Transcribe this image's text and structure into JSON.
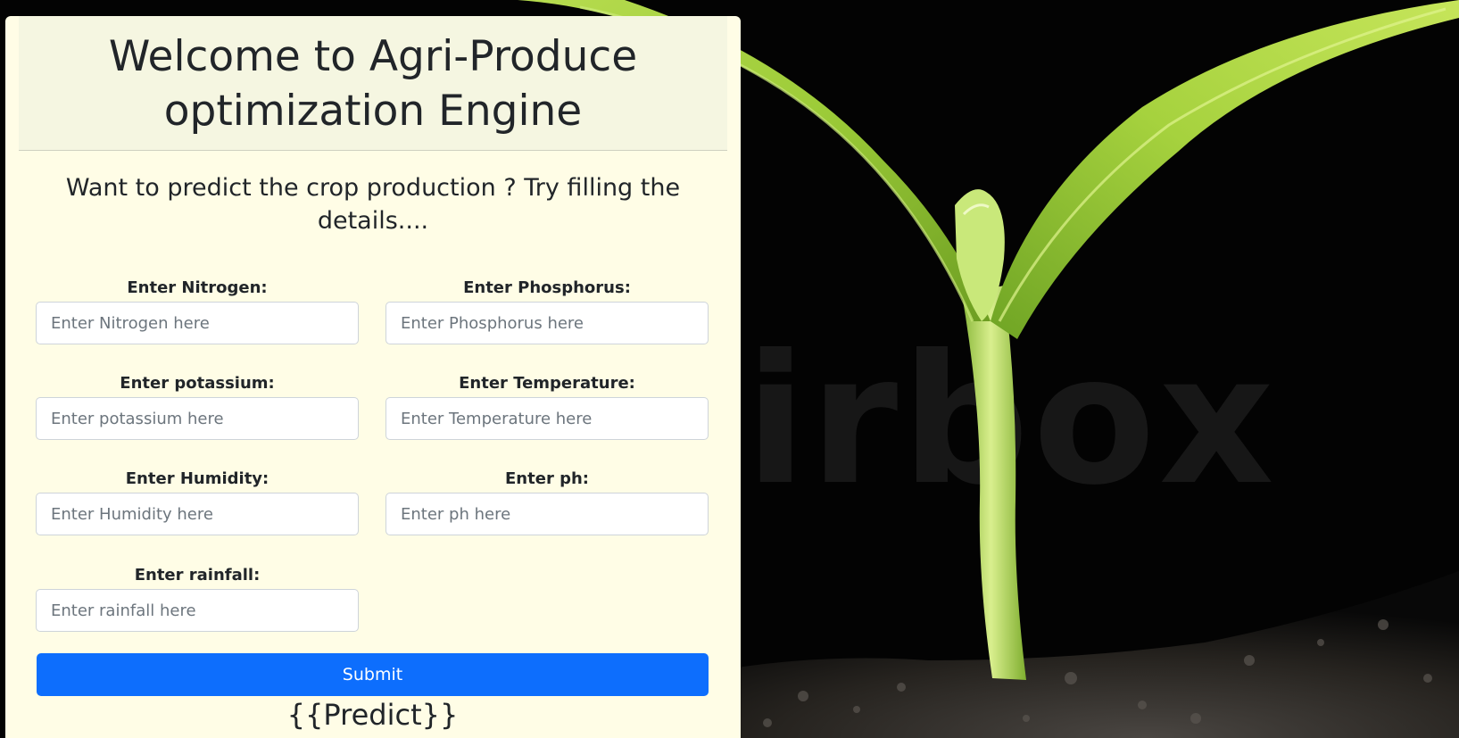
{
  "header": {
    "title": "Welcome to Agri-Produce optimization Engine"
  },
  "form": {
    "subtitle": "Want to predict the crop production ? Try filling the details....",
    "fields": [
      {
        "label": "Enter Nitrogen:",
        "placeholder": "Enter Nitrogen here"
      },
      {
        "label": "Enter Phosphorus:",
        "placeholder": "Enter Phosphorus here"
      },
      {
        "label": "Enter potassium:",
        "placeholder": "Enter potassium here"
      },
      {
        "label": "Enter Temperature:",
        "placeholder": "Enter Temperature here"
      },
      {
        "label": "Enter Humidity:",
        "placeholder": "Enter Humidity here"
      },
      {
        "label": "Enter ph:",
        "placeholder": "Enter ph here"
      },
      {
        "label": "Enter rainfall:",
        "placeholder": "Enter rainfall here"
      }
    ],
    "submit_label": "Submit",
    "result_text": "{{Predict}}"
  },
  "colors": {
    "card_bg": "#fffde6",
    "header_bg": "#f5f6e1",
    "button_bg": "#0d6efd",
    "page_bg": "#030303"
  },
  "background": {
    "watermark": "irbox"
  }
}
